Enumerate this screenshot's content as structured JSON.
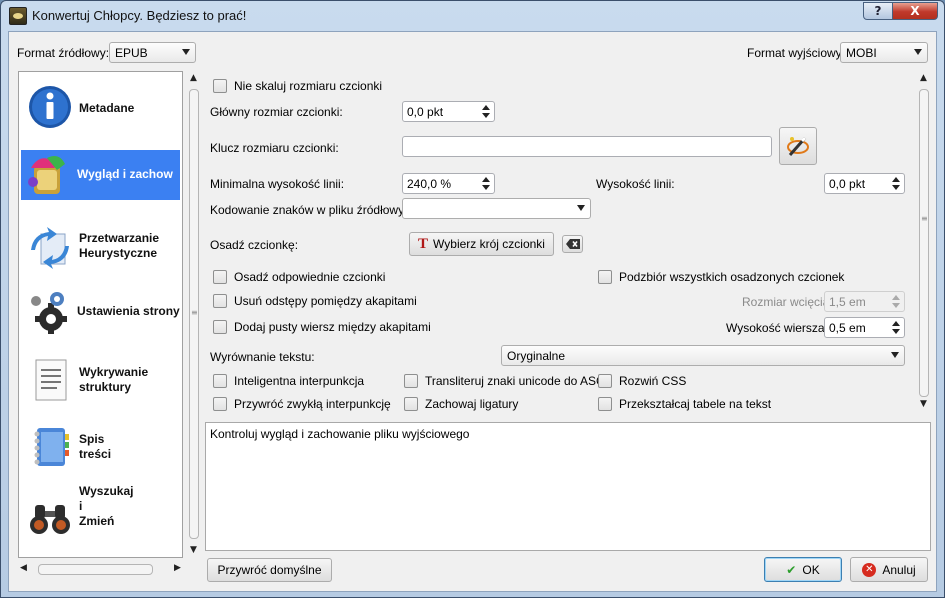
{
  "window": {
    "title": "Konwertuj Chłopcy. Będziesz to prać!",
    "help_label": "?",
    "close_label": "X"
  },
  "input_format": {
    "label": "Format źródłowy:",
    "value": "EPUB"
  },
  "output_format": {
    "label": "Format wyjściowy",
    "value": "MOBI"
  },
  "sidebar": {
    "items": [
      {
        "name": "Metadane",
        "icon": "info-icon"
      },
      {
        "name": "Wygląd i zachow",
        "icon": "paint-icon",
        "selected": true
      },
      {
        "name": "Przetwarzanie\nHeurystyczne",
        "icon": "arrows-icon"
      },
      {
        "name": "Ustawienia strony",
        "icon": "gears-icon"
      },
      {
        "name": "Wykrywanie\nstruktury",
        "icon": "document-icon"
      },
      {
        "name": "Spis\ntreści",
        "icon": "notebook-icon"
      },
      {
        "name": "Wyszukaj\ni\nZmień",
        "icon": "binoculars-icon"
      }
    ]
  },
  "form": {
    "no_scale_label": "Nie skaluj rozmiaru czcionki",
    "base_font_label": "Główny rozmiar czcionki:",
    "base_font_value": "0,0 pkt",
    "font_key_label": "Klucz rozmiaru czcionki:",
    "font_key_value": "",
    "min_line_height_label": "Minimalna wysokość linii:",
    "min_line_height_value": "240,0 %",
    "line_height_label": "Wysokość linii:",
    "line_height_value": "0,0 pkt",
    "encoding_label": "Kodowanie znaków w pliku źródłowym:",
    "encoding_value": "",
    "embed_font_label": "Osadź czcionkę:",
    "choose_font_button": "Wybierz krój czcionki",
    "embed_matching_label": "Osadź odpowiednie czcionki",
    "subset_fonts_label": "Podzbiór wszystkich osadzonych czcionek",
    "remove_spacing_label": "Usuń odstępy pomiędzy akapitami",
    "indent_size_label": "Rozmiar wcięcia",
    "indent_size_value": "1,5 em",
    "insert_blank_label": "Dodaj pusty wiersz między akapitami",
    "blank_line_size_label": "Wysokość wiersza:",
    "blank_line_size_value": "0,5 em",
    "justification_label": "Wyrównanie tekstu:",
    "justification_value": "Oryginalne",
    "smarten_label": "Inteligentna interpunkcja",
    "transliterate_label": "Transliteruj znaki unicode do ASCII",
    "expand_css_label": "Rozwiń CSS",
    "unsmarten_label": "Przywróć zwykłą interpunkcję",
    "keep_ligatures_label": "Zachowaj ligatury",
    "linearize_tables_label": "Przekształcaj tabele na tekst"
  },
  "description": "Kontroluj wygląd i zachowanie pliku wyjściowego",
  "buttons": {
    "restore_defaults": "Przywróć domyślne",
    "ok": "OK",
    "cancel": "Anuluj"
  }
}
